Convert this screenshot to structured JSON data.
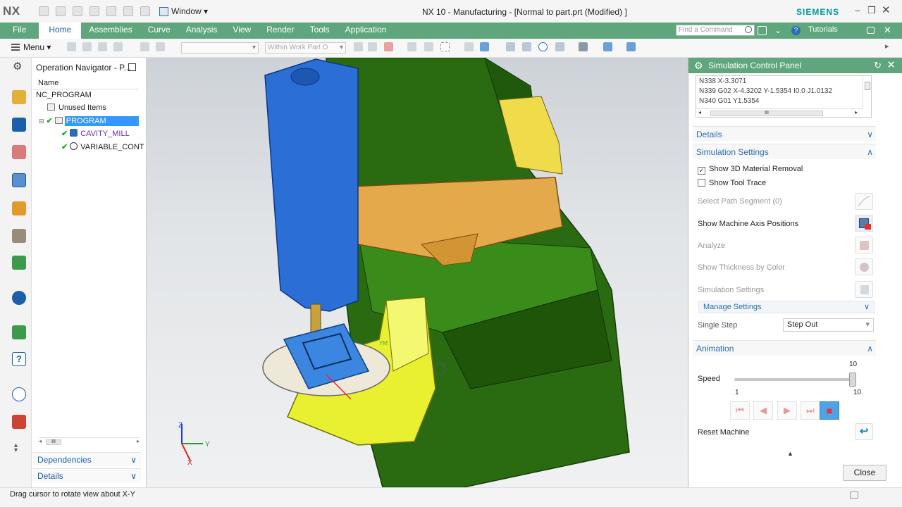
{
  "app": {
    "logo": "NX",
    "title": "NX 10 - Manufacturing - [Normal to part.prt (Modified) ]",
    "brand": "SIEMENS",
    "window_menu": "Window ▾",
    "accent": "#5fa67c",
    "link_color": "#2a6db5"
  },
  "ribbon": {
    "tabs": [
      "File",
      "Home",
      "Assemblies",
      "Curve",
      "Analysis",
      "View",
      "Render",
      "Tools",
      "Application"
    ],
    "active_tab": "Home",
    "command_search_placeholder": "Find a Command",
    "tutorials_label": "Tutorials"
  },
  "toolbar": {
    "menu_label": "Menu ▾",
    "selection_filter": "",
    "scope_filter": "Within Work Part O"
  },
  "navigator": {
    "title": "Operation Navigator - P...",
    "column_header": "Name",
    "root": "NC_PROGRAM",
    "items": [
      {
        "label": "Unused Items"
      },
      {
        "label": "PROGRAM"
      },
      {
        "label": "CAVITY_MILL"
      },
      {
        "label": "VARIABLE_CONT"
      }
    ],
    "scroll_thumb": "III",
    "sections": [
      "Dependencies",
      "Details"
    ]
  },
  "viewport": {
    "axis_labels": {
      "x": "X",
      "y": "Y",
      "z": "Z"
    },
    "part_label": "YM"
  },
  "panel": {
    "title": "Simulation Control Panel",
    "nc_lines": [
      "N338 X-3.3071",
      "N339 G02 X-4.3202 Y-1.5354 I0.0 J1.0132",
      "N340 G01 Y1.5354"
    ],
    "scroll_thumb": "III",
    "details_header": "Details",
    "sim_settings_header": "Simulation Settings",
    "show_3d_material_removal": {
      "label": "Show 3D Material Removal",
      "checked": true
    },
    "show_tool_trace": {
      "label": "Show Tool Trace",
      "checked": false
    },
    "select_path_segment": "Select Path Segment (0)",
    "show_axis_positions": "Show Machine Axis Positions",
    "analyze": "Analyze",
    "show_thickness": "Show Thickness by Color",
    "simulation_settings": "Simulation Settings",
    "manage_settings": "Manage Settings",
    "single_step_label": "Single Step",
    "single_step_value": "Step Out",
    "animation_header": "Animation",
    "speed_label": "Speed",
    "speed_value": 10,
    "speed_value_text": "10",
    "speed_min": "1",
    "speed_max": "10",
    "reset_machine": "Reset Machine",
    "close_label": "Close"
  },
  "status": {
    "text": "Drag cursor to rotate view about X-Y"
  }
}
